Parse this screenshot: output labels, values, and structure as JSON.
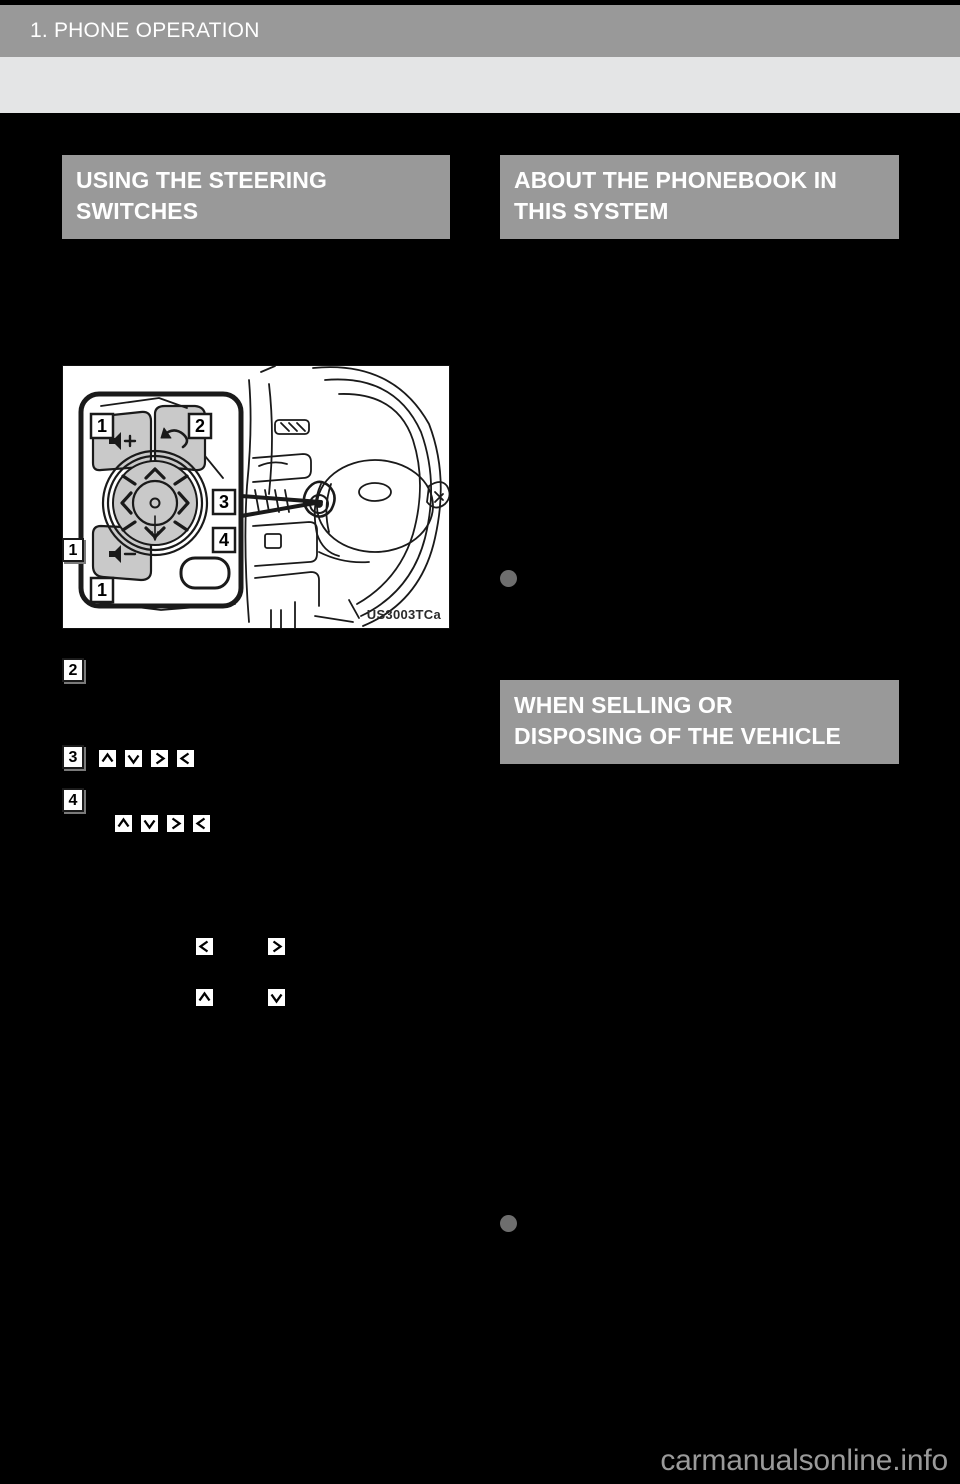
{
  "page": {
    "running_head": "1. PHONE OPERATION",
    "background_color": "#000000",
    "header_band_color": "#999999",
    "subband_color": "#e4e5e6",
    "heading_bar_color": "#999999",
    "heading_text_color": "#ffffff",
    "bullet_color": "#6e6e6e",
    "watermark": "carmanualsonline.info"
  },
  "left_column": {
    "heading": {
      "line1": "USING THE STEERING",
      "line2": "SWITCHES"
    },
    "figure": {
      "code": "US3003TCa",
      "callouts": [
        "1",
        "2",
        "3",
        "4"
      ],
      "control_labels": {
        "volume_up": "volume-up",
        "volume_down": "volume-down",
        "back": "back-arrow",
        "enter": "enter-dot"
      }
    },
    "callouts": [
      {
        "number": "1"
      },
      {
        "number": "2"
      },
      {
        "number": "3"
      },
      {
        "number": "4"
      }
    ],
    "arrow_glyphs": {
      "up": "arrow-up",
      "down": "arrow-down",
      "right": "arrow-right",
      "left": "arrow-left"
    },
    "arrow_rows": [
      {
        "keys": [
          "up",
          "down",
          "right",
          "left"
        ]
      },
      {
        "keys": [
          "up",
          "down",
          "right",
          "left"
        ]
      }
    ],
    "arrow_pairs": [
      {
        "left_key": "left",
        "right_key": "right"
      },
      {
        "left_key": "up",
        "right_key": "down"
      }
    ]
  },
  "right_column": {
    "heading_1": {
      "line1": "ABOUT THE PHONEBOOK IN",
      "line2": "THIS SYSTEM"
    },
    "heading_2": {
      "line1": "WHEN SELLING OR",
      "line2": "DISPOSING OF THE VEHICLE"
    },
    "bullets": [
      {
        "marker": "filled-circle"
      },
      {
        "marker": "filled-circle"
      }
    ]
  }
}
